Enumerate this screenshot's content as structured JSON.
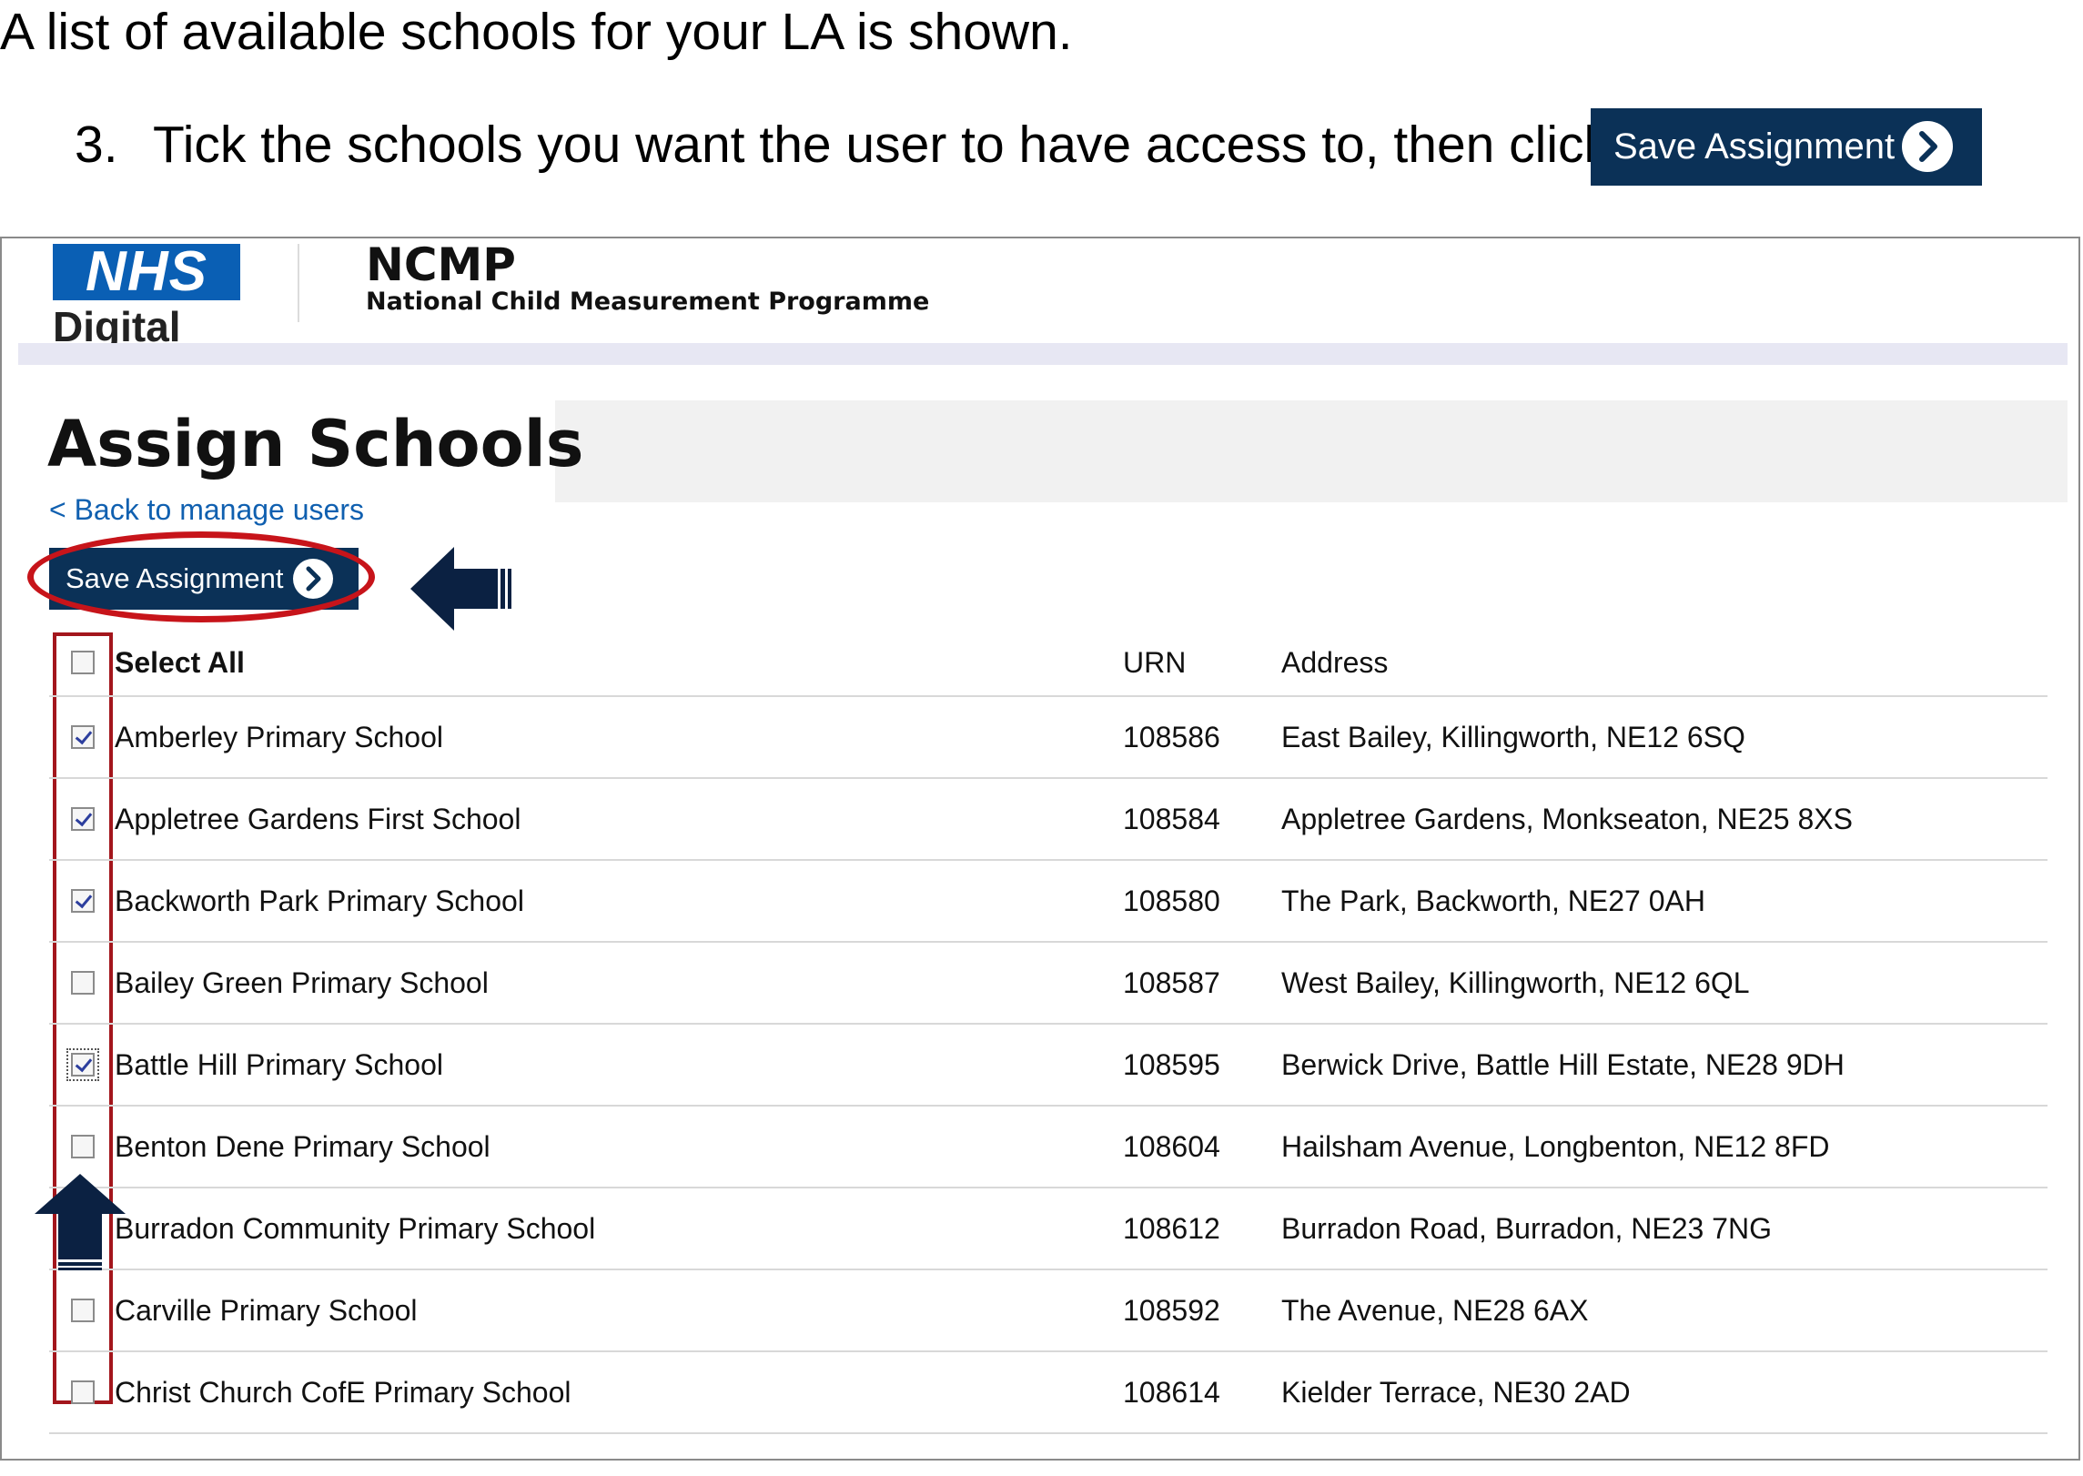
{
  "instructions": {
    "intro": "A list of available schools for your LA is shown.",
    "step_number": "3.",
    "step_text": "Tick the schools you want the user to have access to, then click",
    "step_button_label": "Save Assignment"
  },
  "header": {
    "logo_nhs": "NHS",
    "logo_digital": "Digital",
    "program_title": "NCMP",
    "program_subtitle": "National Child Measurement Programme"
  },
  "page": {
    "title": "Assign Schools",
    "back_link": "< Back to manage users",
    "save_label": "Save Assignment"
  },
  "colors": {
    "button_bg": "#0b3157",
    "nhs_blue": "#0a5fb4",
    "link": "#1060b0",
    "highlight_red": "#c7141a"
  },
  "table": {
    "select_all_label": "Select All",
    "headers": {
      "urn": "URN",
      "address": "Address"
    },
    "rows": [
      {
        "name": "Amberley Primary School",
        "urn": "108586",
        "address": "East Bailey, Killingworth, NE12 6SQ",
        "checked": true
      },
      {
        "name": "Appletree Gardens First School",
        "urn": "108584",
        "address": "Appletree Gardens, Monkseaton, NE25 8XS",
        "checked": true
      },
      {
        "name": "Backworth Park Primary School",
        "urn": "108580",
        "address": "The Park, Backworth, NE27 0AH",
        "checked": true
      },
      {
        "name": "Bailey Green Primary School",
        "urn": "108587",
        "address": "West Bailey, Killingworth, NE12 6QL",
        "checked": false
      },
      {
        "name": "Battle Hill Primary School",
        "urn": "108595",
        "address": "Berwick Drive, Battle Hill Estate, NE28 9DH",
        "checked": true
      },
      {
        "name": "Benton Dene Primary School",
        "urn": "108604",
        "address": "Hailsham Avenue, Longbenton, NE12 8FD",
        "checked": false
      },
      {
        "name": "Burradon Community Primary School",
        "urn": "108612",
        "address": "Burradon Road, Burradon, NE23 7NG",
        "checked": false
      },
      {
        "name": "Carville Primary School",
        "urn": "108592",
        "address": "The Avenue, NE28 6AX",
        "checked": false
      },
      {
        "name": "Christ Church CofE Primary School",
        "urn": "108614",
        "address": "Kielder Terrace, NE30 2AD",
        "checked": false
      }
    ]
  }
}
